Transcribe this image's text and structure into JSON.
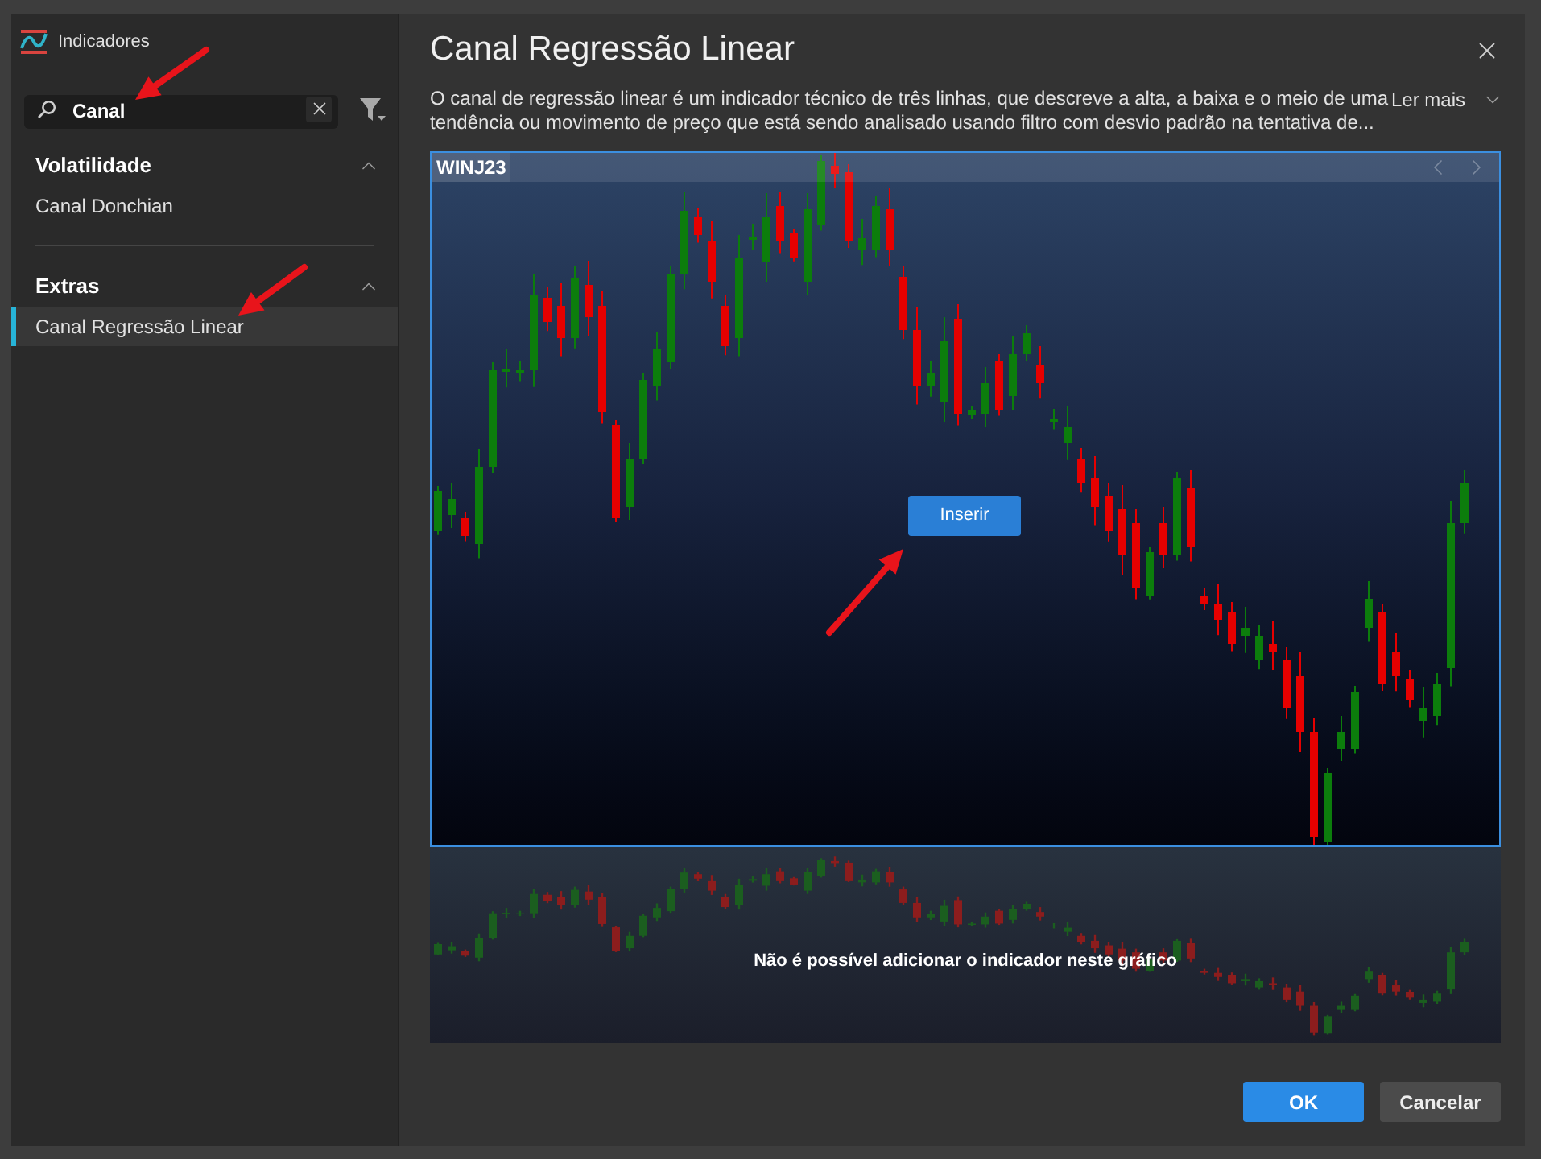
{
  "sidebar": {
    "title": "Indicadores",
    "search": {
      "value": "Canal"
    },
    "groups": [
      {
        "title": "Volatilidade",
        "expanded": true,
        "items": [
          {
            "label": "Canal Donchian",
            "selected": false
          }
        ]
      },
      {
        "title": "Extras",
        "expanded": true,
        "items": [
          {
            "label": "Canal Regressão Linear",
            "selected": true
          }
        ]
      }
    ]
  },
  "detail": {
    "title": "Canal Regressão Linear",
    "description": "O canal de regressão linear é um indicador técnico de três linhas, que descreve a alta, a baixa e o meio de uma tendência ou movimento de preço que está sendo analisado usando filtro com desvio padrão na tentativa de...",
    "read_more": "Ler mais"
  },
  "preview": {
    "symbol": "WINJ23",
    "insert_button": "Inserir",
    "notice": "Não é possível adicionar o indicador neste gráfico"
  },
  "buttons": [
    {
      "label": "OK",
      "kind": "primary"
    },
    {
      "label": "Cancelar",
      "kind": "secondary"
    }
  ]
}
